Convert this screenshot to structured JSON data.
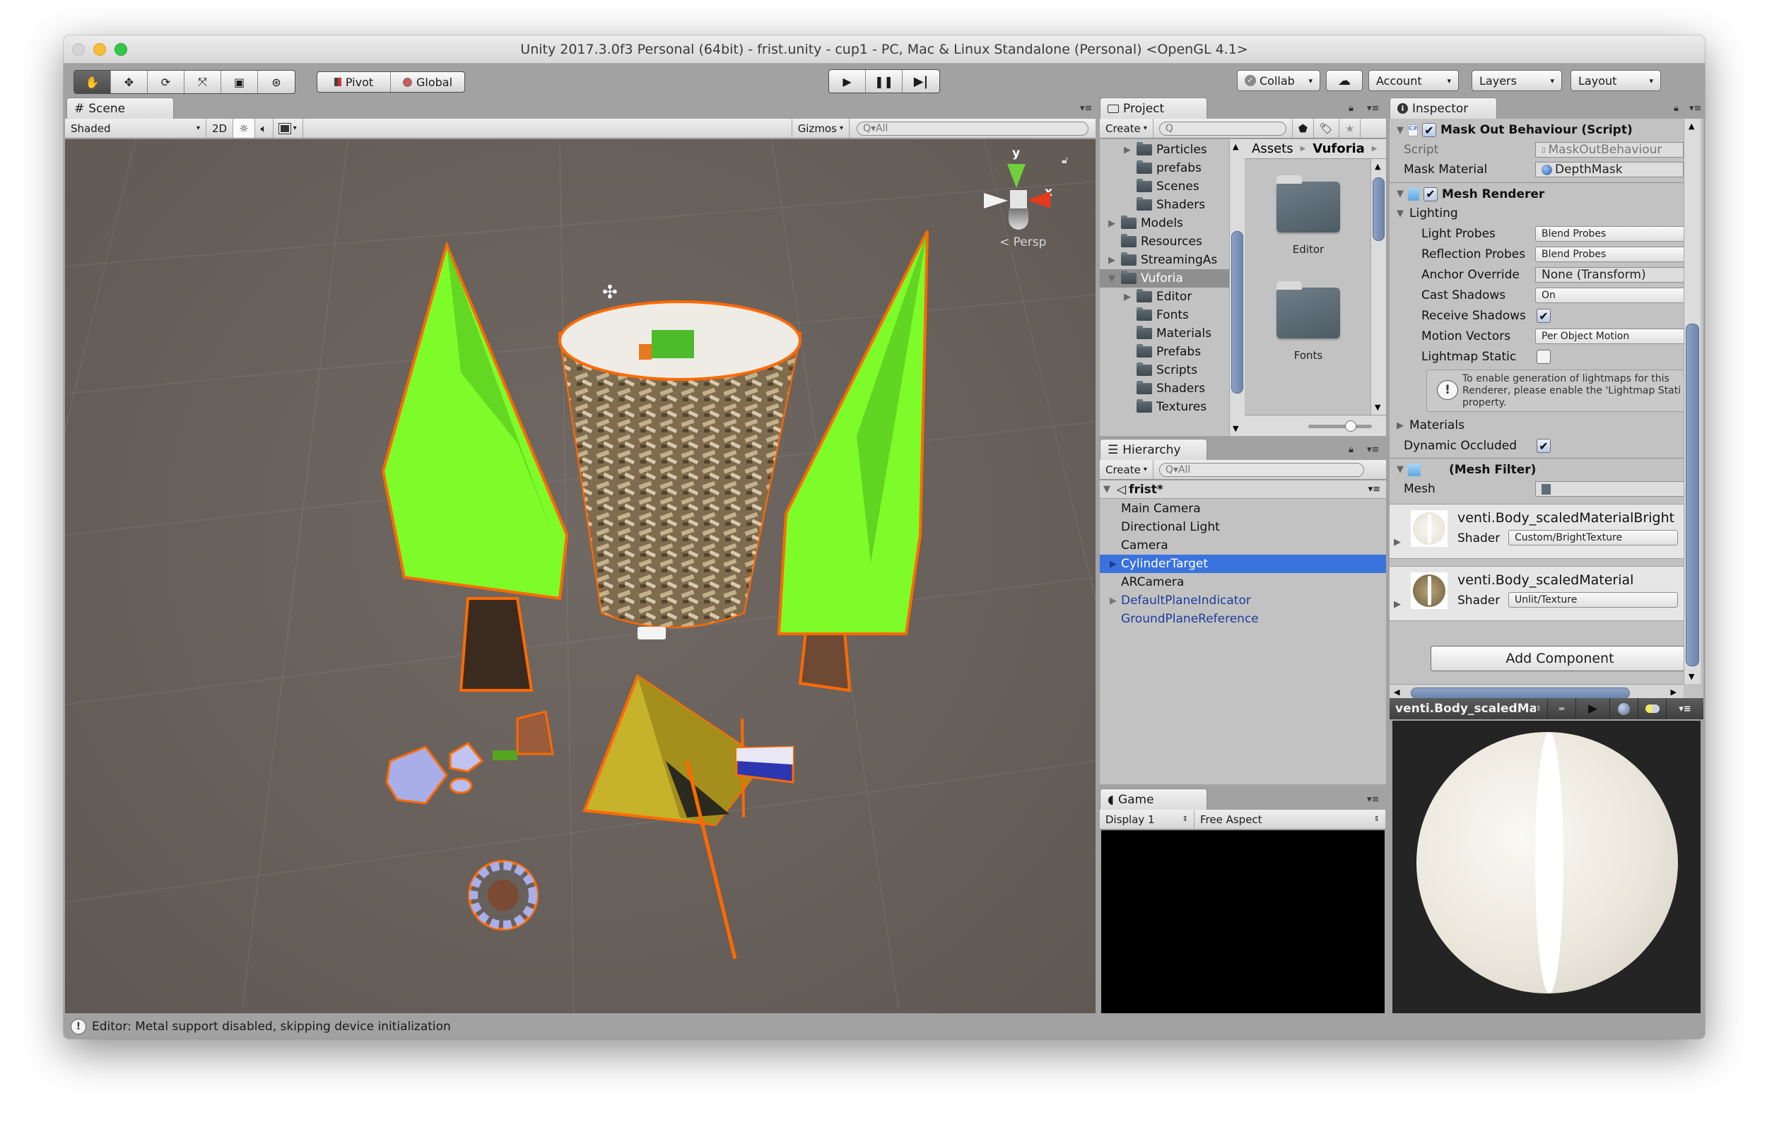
{
  "window": {
    "title": "Unity 2017.3.0f3 Personal (64bit) - frist.unity - cup1 - PC, Mac & Linux Standalone (Personal) <OpenGL 4.1>"
  },
  "toolbar": {
    "tools": [
      {
        "name": "hand-tool",
        "icon": "hand-icon",
        "glyph": "✋",
        "active": true
      },
      {
        "name": "move-tool",
        "icon": "move-icon",
        "glyph": "✥",
        "active": false
      },
      {
        "name": "rotate-tool",
        "icon": "rotate-icon",
        "glyph": "⟳",
        "active": false
      },
      {
        "name": "scale-tool",
        "icon": "scale-icon",
        "glyph": "⤧",
        "active": false
      },
      {
        "name": "rect-tool",
        "icon": "rect-icon",
        "glyph": "▣",
        "active": false
      },
      {
        "name": "transform-tool",
        "icon": "transform-icon",
        "glyph": "⊛",
        "active": false
      }
    ],
    "pivot_label": "Pivot",
    "global_label": "Global",
    "play_glyph": "▶",
    "pause_glyph": "❚❚",
    "step_glyph": "▶|",
    "collab_label": "Collab",
    "account_label": "Account",
    "layers_label": "Layers",
    "layout_label": "Layout",
    "caret": "▾"
  },
  "scene": {
    "tab_label": "Scene",
    "tab_icon": "#",
    "shading_mode": "Shaded",
    "mode_2d": "2D",
    "gizmos_label": "Gizmos",
    "search_placeholder": "Q▾All",
    "persp_label": "< Persp",
    "axis_y": "y",
    "axis_x": "x"
  },
  "project": {
    "tab_label": "Project",
    "create_label": "Create",
    "search_placeholder": "Q",
    "tree": [
      {
        "label": "Particles",
        "depth": 2,
        "expandable": true
      },
      {
        "label": "prefabs",
        "depth": 2,
        "expandable": false
      },
      {
        "label": "Scenes",
        "depth": 2,
        "expandable": false
      },
      {
        "label": "Shaders",
        "depth": 2,
        "expandable": false
      },
      {
        "label": "Models",
        "depth": 1,
        "expandable": true
      },
      {
        "label": "Resources",
        "depth": 1,
        "expandable": false
      },
      {
        "label": "StreamingAs",
        "depth": 1,
        "expandable": true
      },
      {
        "label": "Vuforia",
        "depth": 1,
        "expandable": true,
        "expanded": true,
        "selected": true
      },
      {
        "label": "Editor",
        "depth": 2,
        "expandable": true
      },
      {
        "label": "Fonts",
        "depth": 2,
        "expandable": false
      },
      {
        "label": "Materials",
        "depth": 2,
        "expandable": false
      },
      {
        "label": "Prefabs",
        "depth": 2,
        "expandable": false
      },
      {
        "label": "Scripts",
        "depth": 2,
        "expandable": false
      },
      {
        "label": "Shaders",
        "depth": 2,
        "expandable": false
      },
      {
        "label": "Textures",
        "depth": 2,
        "expandable": false
      }
    ],
    "breadcrumb": [
      "Assets",
      "Vuforia"
    ],
    "grid_items": [
      "Editor",
      "Fonts"
    ]
  },
  "hierarchy": {
    "tab_label": "Hierarchy",
    "create_label": "Create",
    "search_placeholder": "Q▾All",
    "scene_name": "frist*",
    "items": [
      {
        "label": "Main Camera",
        "prefab": false,
        "selected": false,
        "expandable": false
      },
      {
        "label": "Directional Light",
        "prefab": false,
        "selected": false,
        "expandable": false
      },
      {
        "label": "Camera",
        "prefab": false,
        "selected": false,
        "expandable": false
      },
      {
        "label": "CylinderTarget",
        "prefab": true,
        "selected": true,
        "expandable": true
      },
      {
        "label": "ARCamera",
        "prefab": false,
        "selected": false,
        "expandable": false
      },
      {
        "label": "DefaultPlaneIndicator",
        "prefab": true,
        "selected": false,
        "expandable": true
      },
      {
        "label": "GroundPlaneReference",
        "prefab": true,
        "selected": false,
        "expandable": false
      }
    ]
  },
  "game": {
    "tab_label": "Game",
    "display": "Display 1",
    "aspect": "Free Aspect"
  },
  "inspector": {
    "tab_label": "Inspector",
    "mask_out": {
      "title": "Mask Out Behaviour (Script)",
      "enabled": true,
      "script_label": "Script",
      "script_value": "MaskOutBehaviour",
      "mask_material_label": "Mask Material",
      "mask_material_value": "DepthMask"
    },
    "mesh_renderer": {
      "title": "Mesh Renderer",
      "enabled": true,
      "lighting_label": "Lighting",
      "light_probes_label": "Light Probes",
      "light_probes_value": "Blend Probes",
      "reflection_probes_label": "Reflection Probes",
      "reflection_probes_value": "Blend Probes",
      "anchor_override_label": "Anchor Override",
      "anchor_override_value": "None (Transform)",
      "cast_shadows_label": "Cast Shadows",
      "cast_shadows_value": "On",
      "receive_shadows_label": "Receive Shadows",
      "receive_shadows": true,
      "motion_vectors_label": "Motion Vectors",
      "motion_vectors_value": "Per Object Motion",
      "lightmap_static_label": "Lightmap Static",
      "lightmap_static": false,
      "help_text": "To enable generation of lightmaps for this Renderer, please enable the 'Lightmap Stati property.",
      "materials_label": "Materials",
      "dynamic_occluded_label": "Dynamic Occluded",
      "dynamic_occluded": true
    },
    "mesh_filter": {
      "title": "(Mesh Filter)",
      "mesh_label": "Mesh",
      "mesh_value": ""
    },
    "materials": [
      {
        "name": "venti.Body_scaledMaterialBright",
        "shader_label": "Shader",
        "shader": "Custom/BrightTexture",
        "tint": "#f1efe9"
      },
      {
        "name": "venti.Body_scaledMaterial",
        "shader_label": "Shader",
        "shader": "Unlit/Texture",
        "tint": "#9e8a62"
      }
    ],
    "add_component_label": "Add Component",
    "check_glyph": "✔"
  },
  "preview": {
    "title": "venti.Body_scaledMate",
    "play_glyph": "▶"
  },
  "status": {
    "message": "Editor: Metal support disabled, skipping device initialization"
  },
  "colors": {
    "selection": "#3a72de",
    "prefab_text": "#1c3d9a",
    "scene_bg": "#6b635e"
  }
}
